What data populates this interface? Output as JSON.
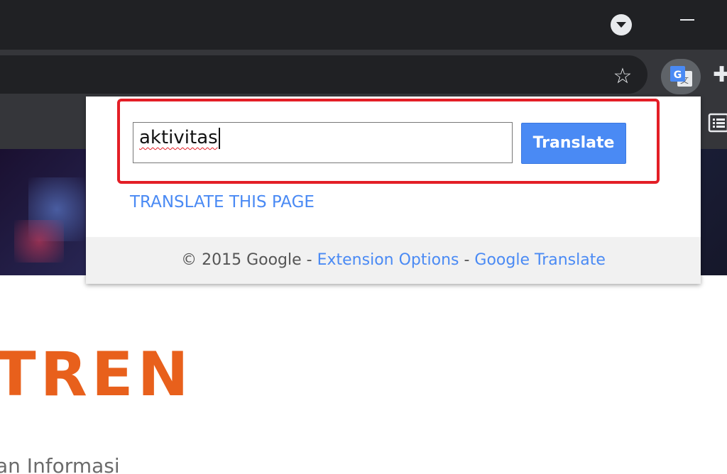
{
  "browser": {
    "tab_search_icon": "chevron-down-icon",
    "minimize_icon": "minimize-icon",
    "bookmark_icon": "star-icon",
    "extension_icon": "google-translate-icon",
    "puzzle_icon": "puzzle-icon",
    "reader_icon": "reader-mode-icon"
  },
  "popup": {
    "input_value": "aktivitas",
    "translate_button": "Translate",
    "translate_page_link": "TRANSLATE THIS PAGE",
    "footer": {
      "copyright": "© 2015 Google - ",
      "extension_options": "Extension Options",
      "separator": " - ",
      "google_translate": "Google Translate"
    },
    "highlight_color": "#e31e26",
    "button_color": "#4a8af4"
  },
  "page": {
    "logo_text": "TREN",
    "logo_color": "#e8601c",
    "subtext": "an Informasi"
  }
}
